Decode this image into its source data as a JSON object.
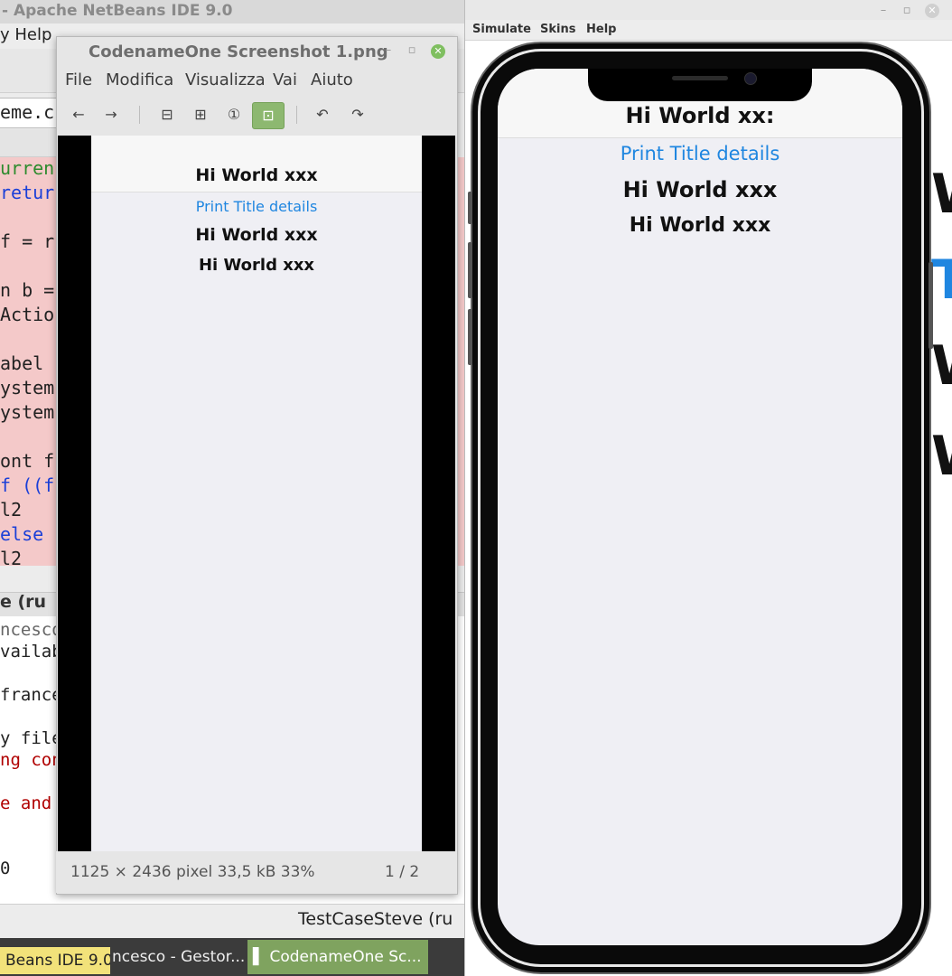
{
  "netbeans": {
    "title": "- Apache NetBeans IDE 9.0",
    "menu_help": "y  Help",
    "tab_label": "eme.cs",
    "editor_lines": [
      {
        "text": "urren",
        "color": "#2e8b2e"
      },
      {
        "text": "retur",
        "color": "#1a3fd8"
      },
      {
        "text": "",
        "color": "#222"
      },
      {
        "text": "f = r",
        "color": "#222"
      },
      {
        "text": "",
        "color": "#222"
      },
      {
        "text": "n b =",
        "color": "#222"
      },
      {
        "text": "Actio",
        "color": "#222"
      },
      {
        "text": "",
        "color": "#222"
      },
      {
        "text": "abel",
        "color": "#222"
      },
      {
        "text": "ystem",
        "color": "#222"
      },
      {
        "text": "ystem",
        "color": "#222"
      },
      {
        "text": "",
        "color": "#222"
      },
      {
        "text": "ont f",
        "color": "#222"
      },
      {
        "text": "f ((f",
        "color": "#1a3fd8"
      },
      {
        "text": "   l2",
        "color": "#222"
      },
      {
        "text": " else",
        "color": "#1a3fd8"
      },
      {
        "text": "   l2",
        "color": "#222"
      }
    ],
    "output_title": "e (ru",
    "output_lines": [
      {
        "text": "ncesco",
        "color": "#666"
      },
      {
        "text": "vailab",
        "color": "#222"
      },
      {
        "text": "",
        "color": "#222"
      },
      {
        "text": "france",
        "color": "#222"
      },
      {
        "text": "",
        "color": "#222"
      },
      {
        "text": "y file",
        "color": "#222"
      },
      {
        "text": "ng con",
        "color": "#b00000"
      },
      {
        "text": "",
        "color": "#222"
      },
      {
        "text": "e and",
        "color": "#b00000"
      },
      {
        "text": "",
        "color": "#222"
      },
      {
        "text": "",
        "color": "#222"
      },
      {
        "text": "0",
        "color": "#222"
      }
    ],
    "status_text": "TestCaseSteve (ru"
  },
  "taskbar": {
    "netbeans": "Beans IDE 9.0",
    "explorer": "ncesco - Gestor...",
    "viewer": "▌ CodenameOne Sc..."
  },
  "viewer": {
    "title": "CodenameOne Screenshot 1.png",
    "menu": [
      "File",
      "Modifica",
      "Visualizza",
      "Vai",
      "Aiuto"
    ],
    "tools": {
      "back": "←",
      "forward": "→",
      "zoom_out": "⊟",
      "zoom_in": "⊞",
      "actual_size": "①",
      "best_fit": "⊡",
      "rotate_left": "↶",
      "rotate_right": "↷"
    },
    "image_title": "Hi World xxx",
    "image_link": "Print Title details",
    "image_line1": "Hi World xxx",
    "image_line2": "Hi World xxx",
    "status": "1125 × 2436 pixel   33,5 kB    33%",
    "page": "1 / 2",
    "colors": {
      "best_fit_active": "#8db870",
      "link": "#1f86e0"
    }
  },
  "simulator": {
    "menu": [
      "Simulate",
      "Skins",
      "Help"
    ],
    "title": "Hi World xx:",
    "link": "Print Title details",
    "line1": "Hi World xxx",
    "line2": "Hi World xxx",
    "colors": {
      "link": "#1f86e0"
    }
  }
}
